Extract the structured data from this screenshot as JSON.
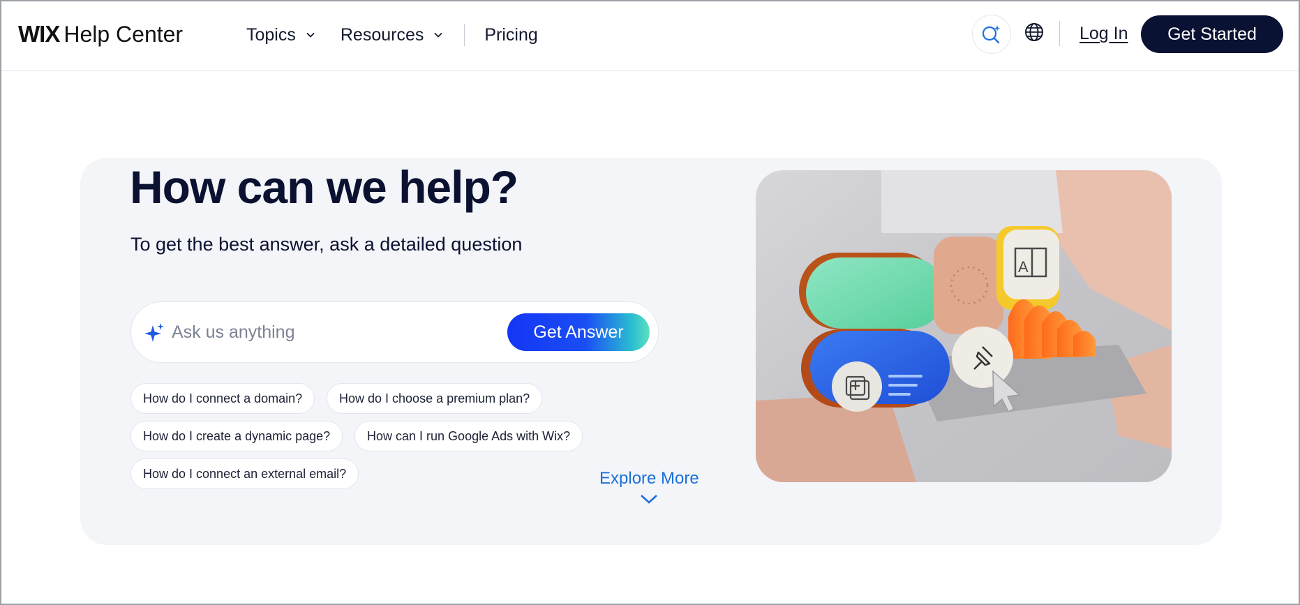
{
  "header": {
    "logo_wordmark": "WIX",
    "logo_text": "Help Center",
    "nav": [
      {
        "label": "Topics",
        "has_dropdown": true
      },
      {
        "label": "Resources",
        "has_dropdown": true
      },
      {
        "label": "Pricing",
        "has_dropdown": false
      }
    ],
    "icons": [
      "ai-search-icon",
      "globe-icon"
    ],
    "login_label": "Log In",
    "get_started_label": "Get Started"
  },
  "hero": {
    "title": "How can we help?",
    "subtitle": "To get the best answer, ask a detailed question",
    "search": {
      "placeholder": "Ask us anything",
      "value": "",
      "button_label": "Get Answer",
      "icon": "sparkle-icon"
    },
    "suggestions": [
      "How do I connect a domain?",
      "How do I choose a premium plan?",
      "How do I create a dynamic page?",
      "How can I run Google Ads with Wix?",
      "How do I connect an external email?"
    ],
    "explore_label": "Explore More"
  },
  "colors": {
    "primary_dark": "#0a1233",
    "accent_blue": "#1436f5",
    "link_blue": "#1c6fd8",
    "hero_bg": "#f3f5f8"
  }
}
